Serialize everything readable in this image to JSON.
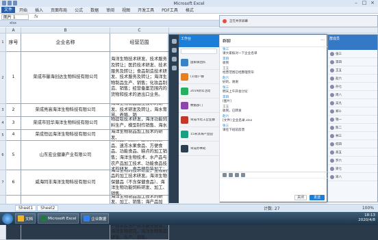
{
  "window": {
    "title": "Microsoft Excel"
  },
  "ribbon": {
    "file": "文件",
    "tabs": [
      "开始",
      "插入",
      "页面布局",
      "公式",
      "数据",
      "审阅",
      "视图",
      "开发工具",
      "PDF工具",
      "格式"
    ]
  },
  "formula_bar": {
    "name_box": "图片 1",
    "fx": "fx"
  },
  "doc_tab": {
    "name": "xlsx"
  },
  "columns": [
    "A",
    "B",
    "C"
  ],
  "rows": [
    {
      "rowno": "1",
      "a": "序号",
      "b": "企业名称",
      "c": "经营范围"
    },
    {
      "rowno": "2",
      "a": "1",
      "b": "荣成市馨海创达生物科技有限公司",
      "c": "海洋生物技术研发、技术服务及转让；医药技术研发、技术服务及转让；食品制造技术研发、技术服务及转让；海洋生物制品生产、销售；化妆品制造、销售；经营备案范围内的货物和技术的进出口业务。"
    },
    {
      "rowno": "3",
      "a": "2",
      "b": "荣成亮高海洋生物科技有限公司",
      "c": "海洋生物制品加工技术的研发、技术研发及转让，海水育苗、养殖、销"
    },
    {
      "rowno": "4",
      "a": "3",
      "b": "荣成市冠华海洋生物科技有限公司",
      "c": "海洋生物制品的技术研究、生物提取技术研发，海洋功能饲料生产，模型制作销售、海水养殖加工、销售。"
    },
    {
      "rowno": "5",
      "a": "4",
      "b": "荣成恒远海洋生物科技有限公司",
      "c": "海洋生物制品加工技术的研发、"
    },
    {
      "rowno": "6",
      "a": "5",
      "b": "山东宏业健康产业有限公司",
      "c": "保健品、水产食品、药膳品、豆制品、蔬菜、速冻调制食品、速冻水果食品、方便食品、功能食品、糕点的加工销售；海洋生物技术、水产品与农产品加工技术、功能食品技术的研发，食品预包装加工；正餐服务。"
    },
    {
      "rowno": "7",
      "a": "6",
      "b": "威海同丰海洋生物科技有限公司",
      "c": "海洋生物的技术研发；生物制品的加工技术研发。海洋生物保健品（不含保健食品）、海洋生物功能饲料研发、加工、销售。"
    },
    {
      "rowno": "8",
      "a": "7",
      "b": "荣成市森海遗生物科技有限公司",
      "c": "海洋生物制品加工技术的研发、加工、销售；海产品加工、销售；水产品初加工、销售；食品加工及销售（不含化学药品）；海产品养殖，对水产技术及水产技术服务咨询；海洋生物研究，海洋生物制品研发、生产、销售。"
    }
  ],
  "status_bar": {
    "sheet_tabs": [
      "Sheet1",
      "Sheet2"
    ],
    "count": "计数: 27",
    "zoom": "100%"
  },
  "chat": {
    "list_title": "工作台",
    "conversations": [
      "国家级团队",
      "(1)客户群",
      "2019新年活动",
      "数据部门",
      "荣成市化工企业群",
      "15米滨海产业园",
      "荣成办事处"
    ],
    "header": "群聊",
    "messages": [
      {
        "who": "张三",
        "text": "请大家核对一下企业名单"
      },
      {
        "who": "李四",
        "text": "收到"
      },
      {
        "who": "王五",
        "text": "经营范围已经整理完毕"
      },
      {
        "who": "赵六",
        "text": "好的，谢谢"
      },
      {
        "who": "张三",
        "text": "明天上午开会讨论"
      },
      {
        "who": "李四",
        "text": "[图片]"
      },
      {
        "who": "王五",
        "text": "收到，已转发"
      },
      {
        "who": "赵六",
        "text": "[文件] 企业名录.xlsx"
      },
      {
        "who": "张三",
        "text": "请在下班前反馈"
      }
    ],
    "close_label": "关闭",
    "send_label": "发送"
  },
  "panel": {
    "title": "群成员",
    "members": [
      "张三",
      "李四",
      "王五",
      "赵六",
      "孙七",
      "周八",
      "吴九",
      "郑十",
      "钱一",
      "陈二",
      "林三",
      "何四",
      "高五",
      "罗六",
      "梁七",
      "宋八"
    ]
  },
  "floatbar": {
    "text": "正在共享屏幕"
  },
  "taskbar": {
    "items": [
      {
        "label": "文档",
        "color": "#f0b429"
      },
      {
        "label": "Microsoft Excel",
        "color": "#1e7b3a"
      },
      {
        "label": "企业数据",
        "color": "#2f80ed"
      }
    ],
    "time": "18:13",
    "date": "2020/4/8"
  }
}
